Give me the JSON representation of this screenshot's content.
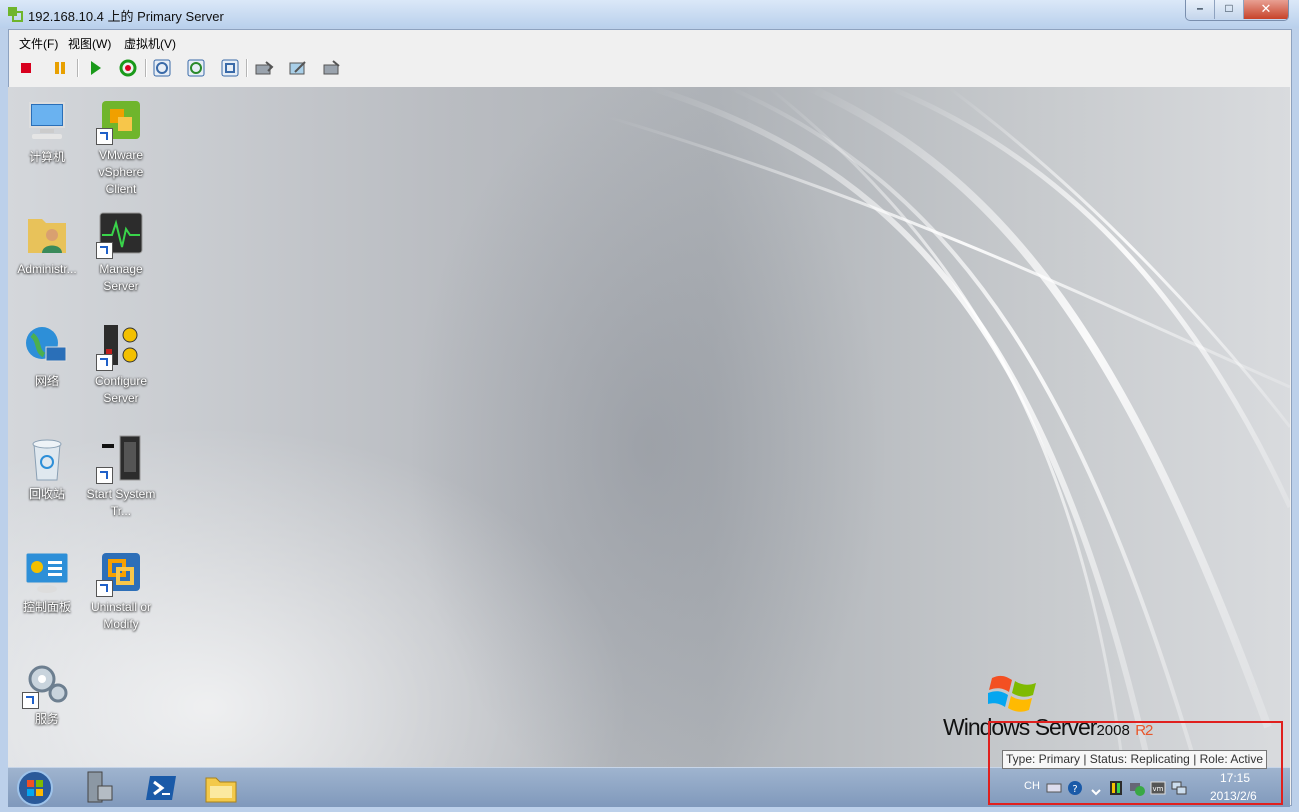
{
  "window": {
    "title": "192.168.10.4 上的 Primary Server",
    "minimize": "–",
    "maximize": "□",
    "close": "✕"
  },
  "menu": [
    {
      "label": "文件(F)"
    },
    {
      "label": "视图(W)"
    },
    {
      "label": "虚拟机(V)"
    }
  ],
  "toolbar": [
    {
      "icon": "stop-icon",
      "color": "#d8001e"
    },
    {
      "icon": "pause-icon",
      "color": "#e8a000"
    },
    {
      "icon": "play-icon",
      "color": "#1a9a1a"
    },
    {
      "icon": "reset-icon",
      "color": "#1a9a1a"
    },
    {
      "icon": "snapshot-icon"
    },
    {
      "icon": "revert-snapshot-icon"
    },
    {
      "icon": "snapshot-manager-icon"
    },
    {
      "icon": "cd-drive-icon"
    },
    {
      "icon": "floppy-drive-icon"
    },
    {
      "icon": "network-adapter-icon"
    }
  ],
  "desktop_icons": [
    {
      "label": "计算机",
      "icon": "computer-icon"
    },
    {
      "label": "VMware vSphere Client",
      "icon": "vsphere-client-icon"
    },
    {
      "label": "Administr...",
      "icon": "user-folder-icon"
    },
    {
      "label": "Manage Server",
      "icon": "manage-server-icon"
    },
    {
      "label": "网络",
      "icon": "network-icon"
    },
    {
      "label": "Configure Server",
      "icon": "configure-server-icon"
    },
    {
      "label": "回收站",
      "icon": "recycle-bin-icon"
    },
    {
      "label": "Start System Tr...",
      "icon": "system-tray-icon"
    },
    {
      "label": "控制面板",
      "icon": "control-panel-icon"
    },
    {
      "label": "Uninstall or Modify",
      "icon": "uninstall-icon"
    },
    {
      "label": "服务",
      "icon": "services-icon"
    }
  ],
  "branding": {
    "windows": "Windows Server",
    "version": "2008",
    "r2": "R2"
  },
  "taskbar": {
    "tooltip": "Type: Primary | Status: Replicating | Role: Active",
    "lang": "CH",
    "time": "17:15",
    "date": "2013/2/6"
  },
  "colors": {
    "accent": "#e0201e",
    "r2": "#e8562a"
  }
}
